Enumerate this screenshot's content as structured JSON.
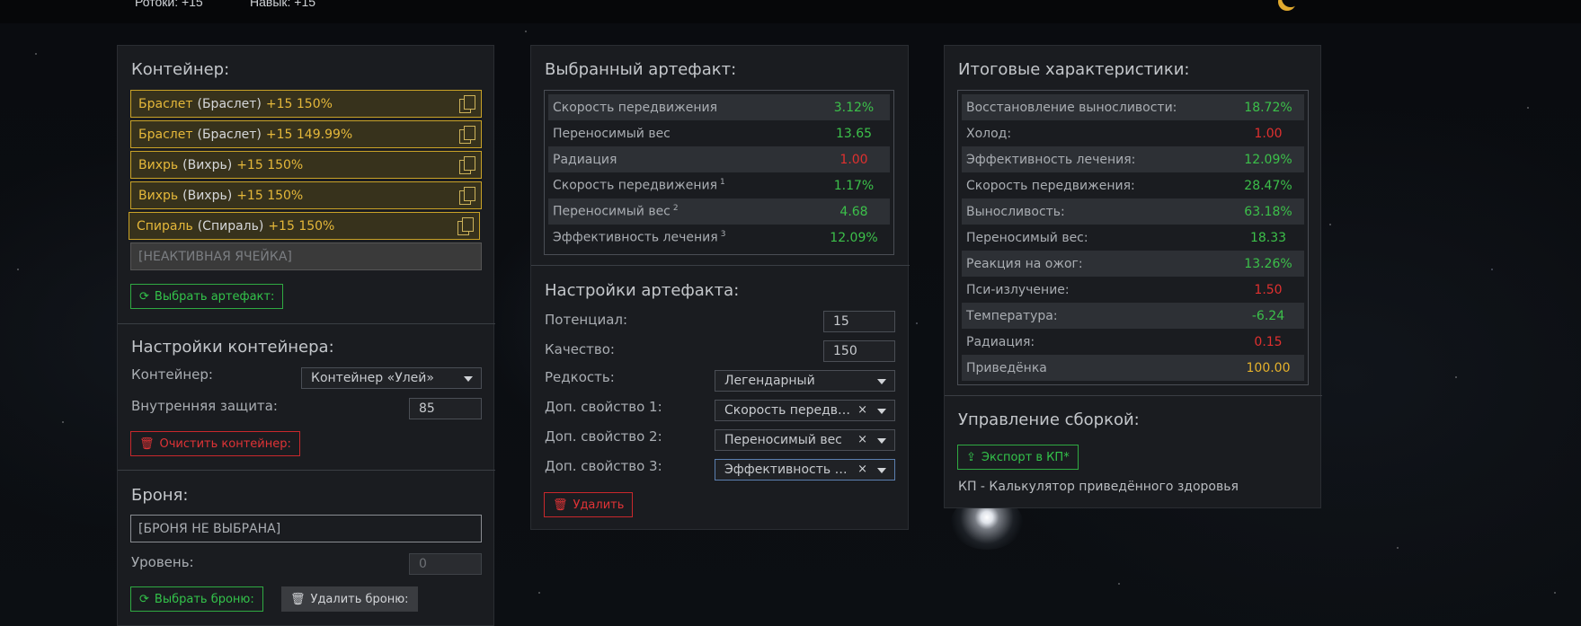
{
  "topbar": {
    "link1": "Ротоки: +15",
    "link2": "Навык: +15"
  },
  "container_panel": {
    "title": "Контейнер:",
    "slots": [
      {
        "artifact": "Браслет",
        "type": "(Браслет)",
        "stats": "+15 150%"
      },
      {
        "artifact": "Браслет",
        "type": "(Браслет)",
        "stats": "+15 149.99%"
      },
      {
        "artifact": "Вихрь",
        "type": "(Вихрь)",
        "stats": "+15 150%"
      },
      {
        "artifact": "Вихрь",
        "type": "(Вихрь)",
        "stats": "+15 150%"
      },
      {
        "artifact": "Спираль",
        "type": "(Спираль)",
        "stats": "+15 150%"
      }
    ],
    "inactive_slot": "[НЕАКТИВНАЯ ЯЧЕЙКА]",
    "select_artifact_button": "Выбрать артефакт:",
    "settings_title": "Настройки контейнера:",
    "container_label": "Контейнер:",
    "container_value": "Контейнер «Улей»",
    "protection_label": "Внутренняя защита:",
    "protection_value": "85",
    "clear_button": "Очистить контейнер:",
    "armor_title": "Броня:",
    "armor_value": "[БРОНЯ НЕ ВЫБРАНА]",
    "level_label": "Уровень:",
    "level_value": "0",
    "select_armor_button": "Выбрать броню:",
    "delete_armor_button": "Удалить броню:"
  },
  "artifact_panel": {
    "title": "Выбранный артефакт:",
    "stats": [
      {
        "name": "Скорость передвижения",
        "sup": "",
        "value": "3.12%",
        "color": "#3cc04a"
      },
      {
        "name": "Переносимый вес",
        "sup": "",
        "value": "13.65",
        "color": "#3cc04a"
      },
      {
        "name": "Радиация",
        "sup": "",
        "value": "1.00",
        "color": "#e0302f"
      },
      {
        "name": "Скорость передвижения",
        "sup": "1",
        "value": "1.17%",
        "color": "#3cc04a"
      },
      {
        "name": "Переносимый вес",
        "sup": "2",
        "value": "4.68",
        "color": "#3cc04a"
      },
      {
        "name": "Эффективность лечения",
        "sup": "3",
        "value": "12.09%",
        "color": "#3cc04a"
      }
    ],
    "settings_title": "Настройки артефакта:",
    "potential_label": "Потенциал:",
    "potential_value": "15",
    "quality_label": "Качество:",
    "quality_value": "150",
    "rarity_label": "Редкость:",
    "rarity_value": "Легендарный",
    "prop1_label": "Доп. свойство 1:",
    "prop1_value": "Скорость передвижения",
    "prop2_label": "Доп. свойство 2:",
    "prop2_value": "Переносимый вес",
    "prop3_label": "Доп. свойство 3:",
    "prop3_value": "Эффективность лечения",
    "delete_button": "Удалить"
  },
  "summary_panel": {
    "title": "Итоговые характеристики:",
    "stats": [
      {
        "name": "Восстановление выносливости:",
        "value": "18.72%",
        "color": "#3cc04a"
      },
      {
        "name": "Холод:",
        "value": "1.00",
        "color": "#e0302f"
      },
      {
        "name": "Эффективность лечения:",
        "value": "12.09%",
        "color": "#3cc04a"
      },
      {
        "name": "Скорость передвижения:",
        "value": "28.47%",
        "color": "#3cc04a"
      },
      {
        "name": "Выносливость:",
        "value": "63.18%",
        "color": "#3cc04a"
      },
      {
        "name": "Переносимый вес:",
        "value": "18.33",
        "color": "#3cc04a"
      },
      {
        "name": "Реакция на ожог:",
        "value": "13.26%",
        "color": "#3cc04a"
      },
      {
        "name": "Пси-излучение:",
        "value": "1.50",
        "color": "#e0302f"
      },
      {
        "name": "Температура:",
        "value": "-6.24",
        "color": "#3cc04a"
      },
      {
        "name": "Радиация:",
        "value": "0.15",
        "color": "#e0302f"
      },
      {
        "name": "Приведёнка",
        "value": "100.00",
        "color": "#e6b22c"
      }
    ],
    "manage_title": "Управление сборкой:",
    "export_button": "Экспорт в КП*",
    "footnote": "КП - Калькулятор приведённого здоровья"
  }
}
